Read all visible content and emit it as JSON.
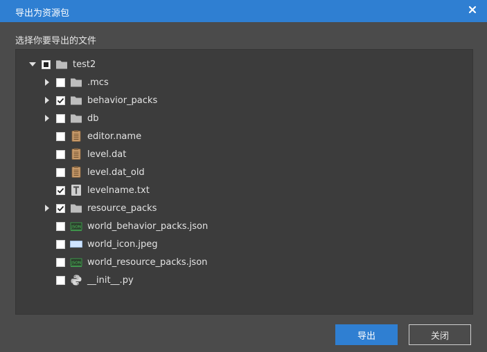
{
  "dialog": {
    "title": "导出为资源包",
    "prompt": "选择你要导出的文件",
    "close_icon": "close-icon"
  },
  "tree": [
    {
      "label": "test2",
      "icon": "folder-icon",
      "expander": "expanded",
      "check": "partial",
      "level": 0
    },
    {
      "label": ".mcs",
      "icon": "folder-icon",
      "expander": "collapsed",
      "check": "unchecked",
      "level": 1
    },
    {
      "label": "behavior_packs",
      "icon": "folder-icon",
      "expander": "collapsed",
      "check": "checked",
      "level": 1
    },
    {
      "label": "db",
      "icon": "folder-icon",
      "expander": "collapsed",
      "check": "unchecked",
      "level": 1
    },
    {
      "label": "editor.name",
      "icon": "file-notes-icon",
      "expander": "none",
      "check": "unchecked",
      "level": 1
    },
    {
      "label": "level.dat",
      "icon": "file-notes-icon",
      "expander": "none",
      "check": "unchecked",
      "level": 1
    },
    {
      "label": "level.dat_old",
      "icon": "file-notes-icon",
      "expander": "none",
      "check": "unchecked",
      "level": 1
    },
    {
      "label": "levelname.txt",
      "icon": "text-file-icon",
      "expander": "none",
      "check": "checked",
      "level": 1
    },
    {
      "label": "resource_packs",
      "icon": "folder-icon",
      "expander": "collapsed",
      "check": "checked",
      "level": 1
    },
    {
      "label": "world_behavior_packs.json",
      "icon": "json-file-icon",
      "expander": "none",
      "check": "unchecked",
      "level": 1
    },
    {
      "label": "world_icon.jpeg",
      "icon": "image-file-icon",
      "expander": "none",
      "check": "unchecked",
      "level": 1
    },
    {
      "label": "world_resource_packs.json",
      "icon": "json-file-icon",
      "expander": "none",
      "check": "unchecked",
      "level": 1
    },
    {
      "label": "__init__.py",
      "icon": "python-file-icon",
      "expander": "none",
      "check": "unchecked",
      "level": 1
    }
  ],
  "buttons": {
    "export": "导出",
    "close": "关闭"
  },
  "colors": {
    "titlebar": "#2f7fd2",
    "dialog_bg": "#4b4b4b",
    "panel_bg": "#3c3c3c",
    "primary": "#2f7fd2"
  }
}
